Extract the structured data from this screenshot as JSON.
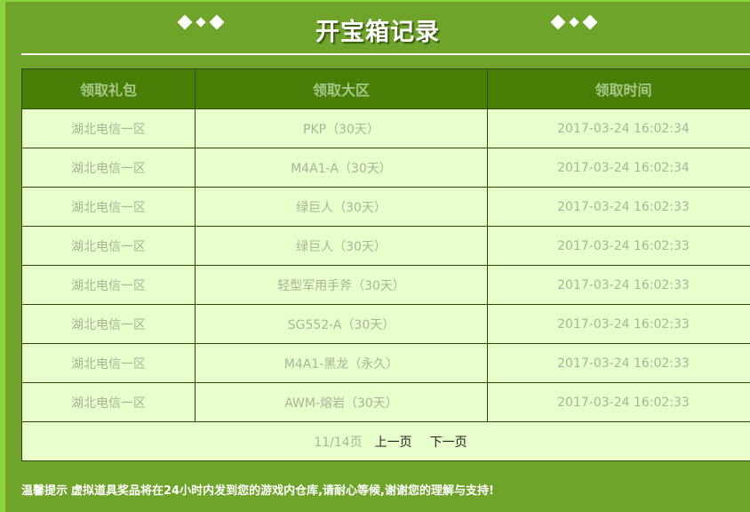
{
  "title": "开宝箱记录",
  "table": {
    "headers": [
      "领取礼包",
      "领取大区",
      "领取时间"
    ],
    "rows": [
      [
        "湖北电信一区",
        "PKP（30天）",
        "2017-03-24 16:02:34"
      ],
      [
        "湖北电信一区",
        "M4A1-A（30天）",
        "2017-03-24 16:02:34"
      ],
      [
        "湖北电信一区",
        "绿巨人（30天）",
        "2017-03-24 16:02:33"
      ],
      [
        "湖北电信一区",
        "绿巨人（30天）",
        "2017-03-24 16:02:33"
      ],
      [
        "湖北电信一区",
        "轻型军用手斧（30天）",
        "2017-03-24 16:02:33"
      ],
      [
        "湖北电信一区",
        "SG552-A（30天）",
        "2017-03-24 16:02:33"
      ],
      [
        "湖北电信一区",
        "M4A1-黑龙（永久）",
        "2017-03-24 16:02:33"
      ],
      [
        "湖北电信一区",
        "AWM-熔岩（30天）",
        "2017-03-24 16:02:33"
      ]
    ]
  },
  "pager": {
    "count": "11/14页",
    "prev": "上一页",
    "next": "下一页"
  },
  "tip": {
    "label": "温馨提示",
    "text": "虚拟道具奖品将在24小时内发到您的游戏内仓库,请耐心等候,谢谢您的理解与支持!"
  }
}
